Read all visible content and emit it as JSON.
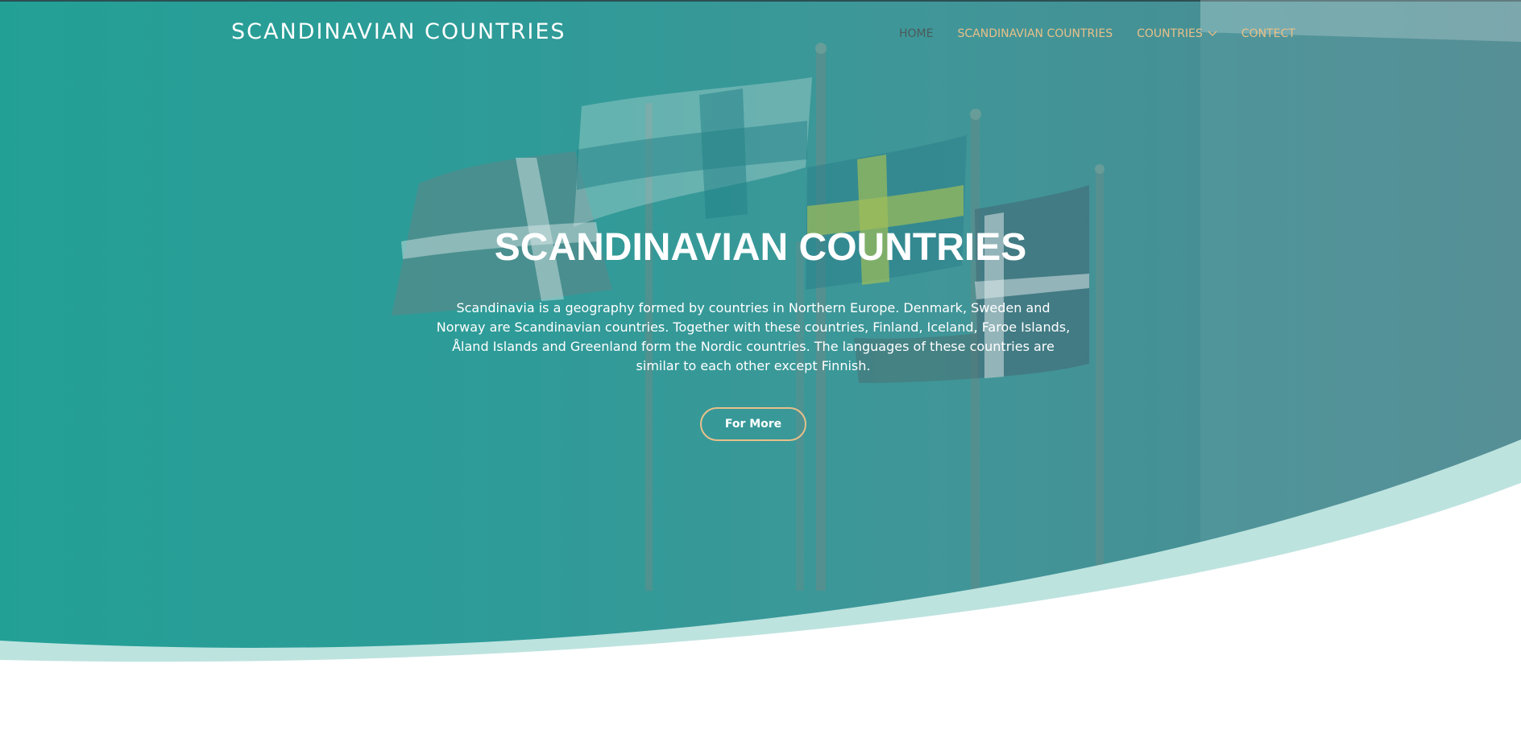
{
  "brand": "SCANDINAVIAN COUNTRIES",
  "nav": {
    "home": "HOME",
    "scandinavian_countries": "SCANDINAVIAN COUNTRIES",
    "countries": "COUNTRIES",
    "contect": "CONTECT"
  },
  "hero": {
    "title": "SCANDINAVIAN COUNTRIES",
    "text": "Scandinavia is a geography formed by countries in Northern Europe. Denmark, Sweden and Norway are Scandinavian countries. Together with these countries, Finland, Iceland, Faroe Islands, Åland Islands and Greenland form the Nordic countries. The languages of these countries are similar to each other except Finnish.",
    "button": "For More"
  },
  "icons": {
    "countries_dropdown": "chevron-down-icon"
  },
  "colors": {
    "hero_teal": "#23a096",
    "accent_gold": "#e8c089",
    "wave_light": "#bde3df",
    "nav_active": "#4c5a5a"
  }
}
